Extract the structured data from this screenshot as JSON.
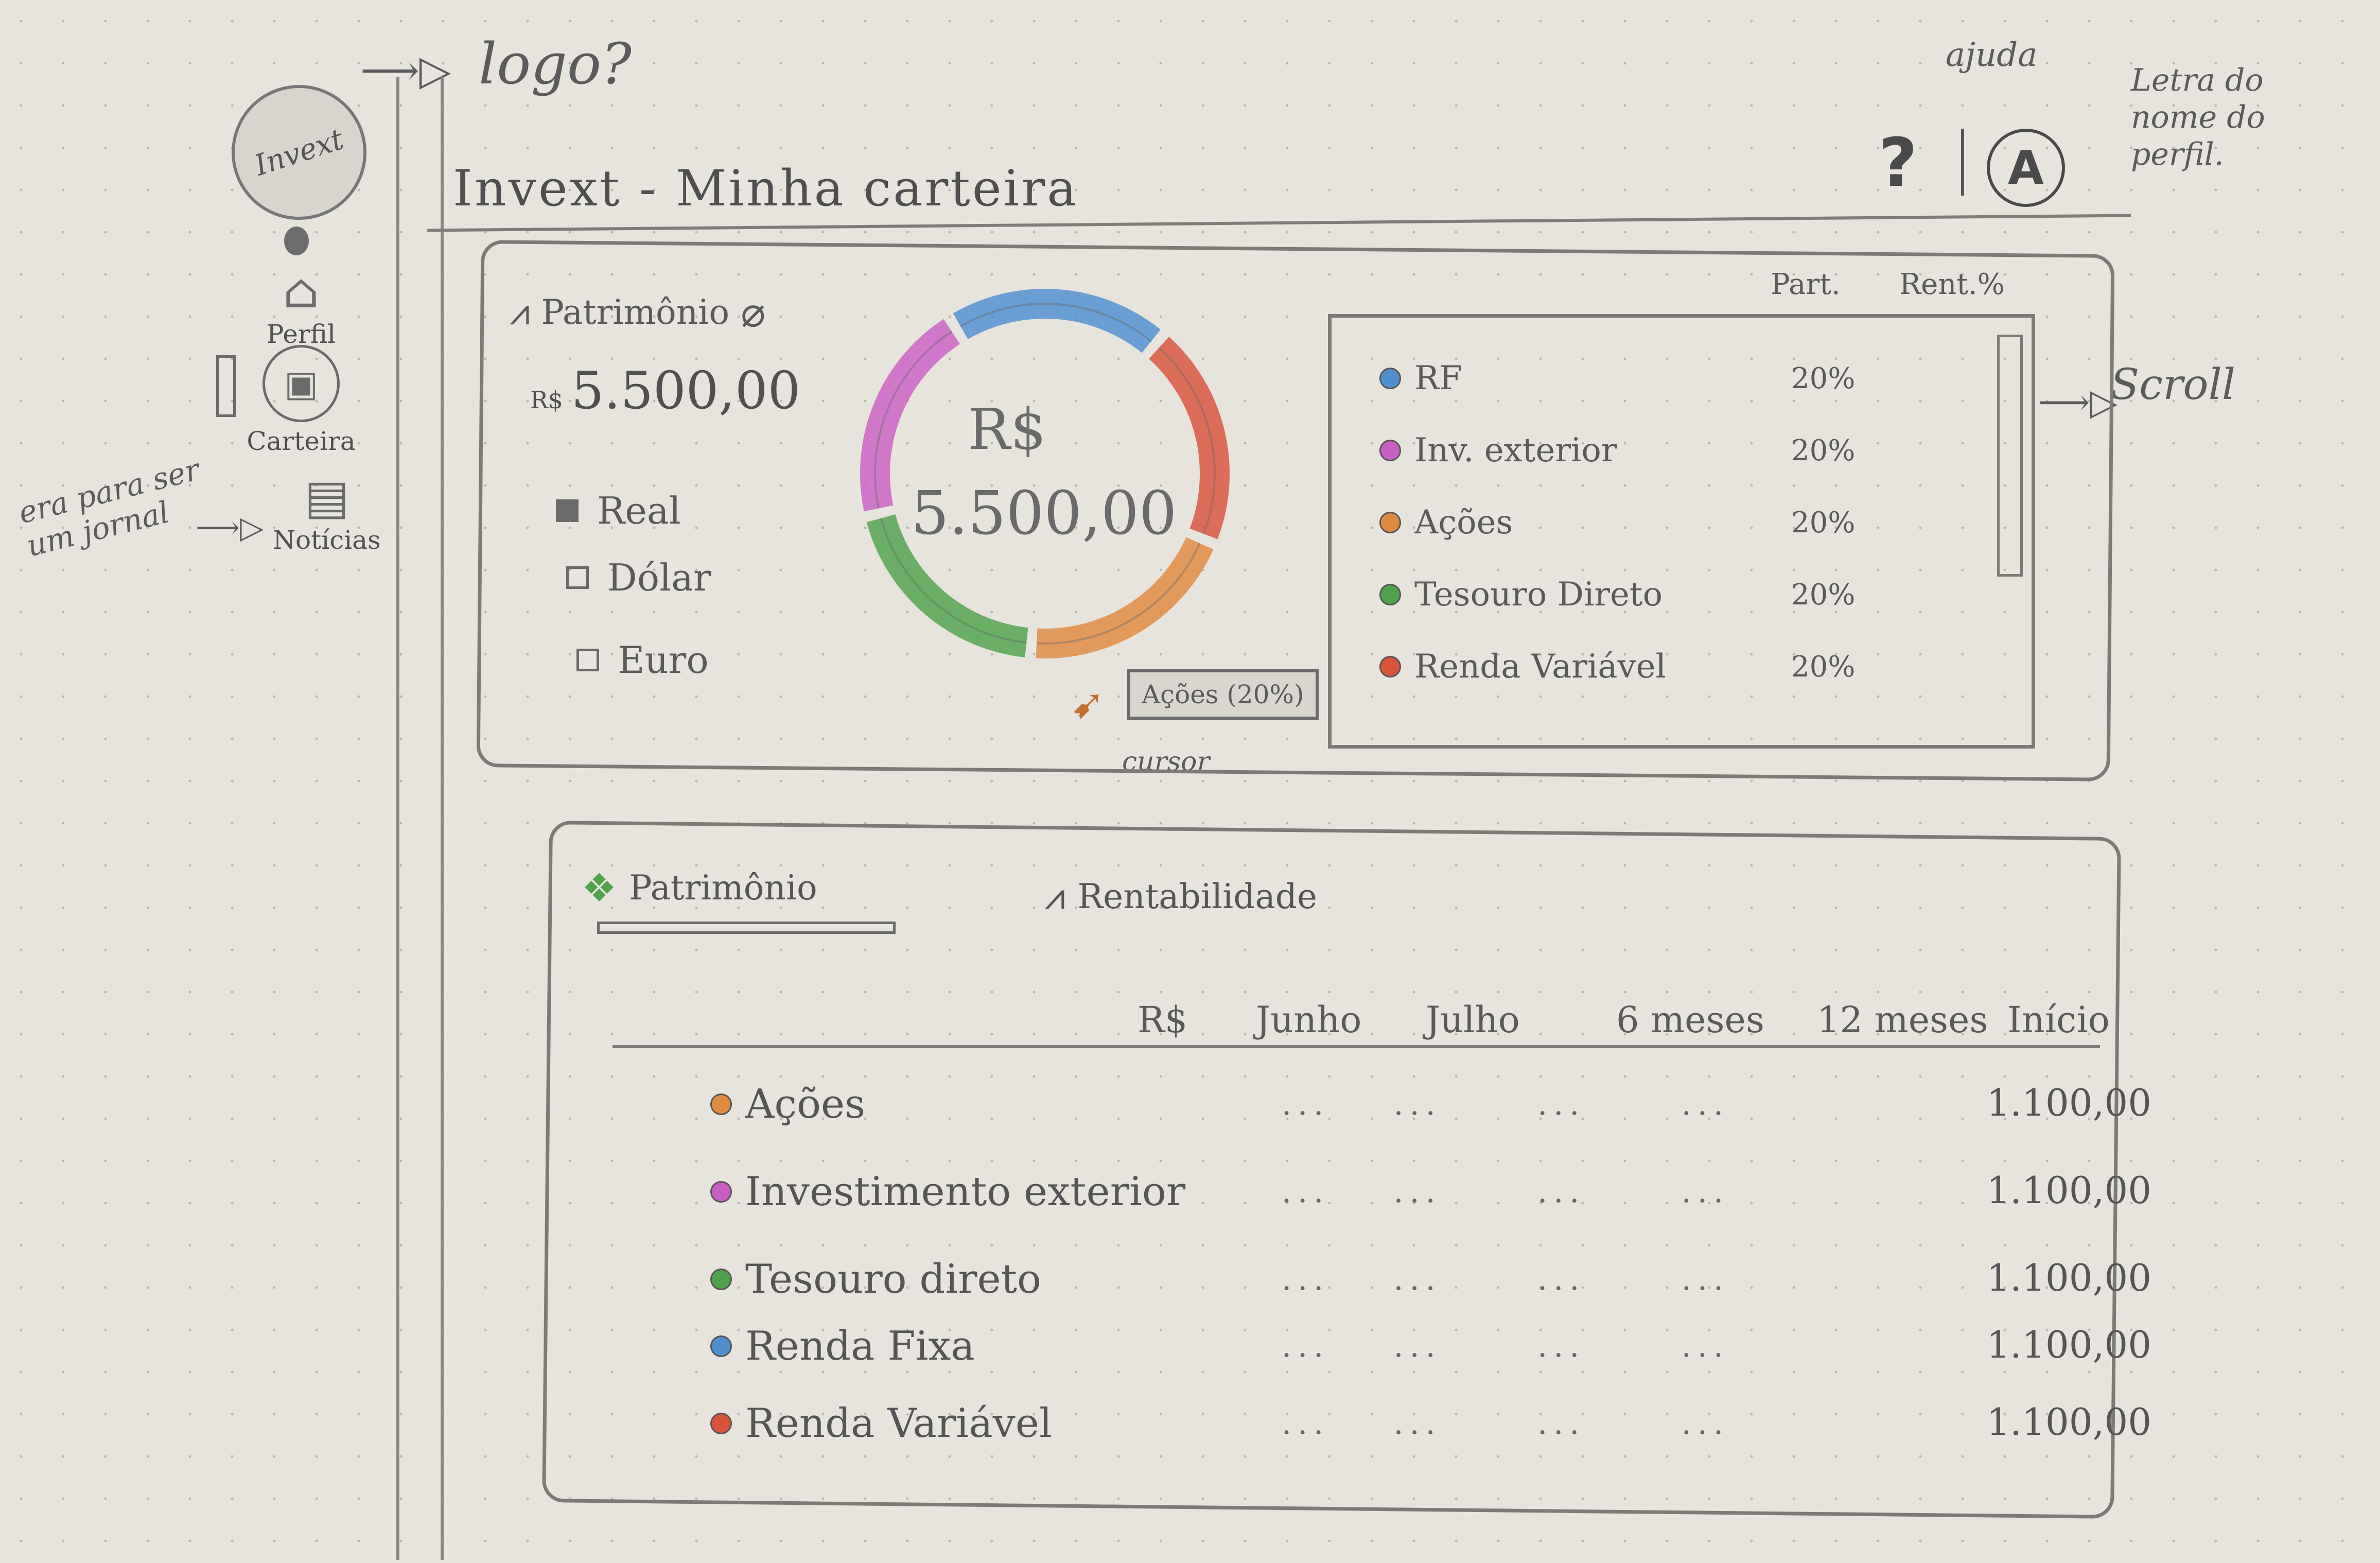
{
  "annotations": {
    "logo_note": "logo?",
    "help_note": "ajuda",
    "profile_note": "Letra do nome do perfil.",
    "scroll_note": "Scroll",
    "journal_note": "era para ser um jornal",
    "cursor_note": "cursor"
  },
  "app": {
    "logo_text": "Invext",
    "title": "Invext - Minha carteira",
    "help_icon_label": "?",
    "profile_letter": "A"
  },
  "sidebar": {
    "items": [
      {
        "label": "Perfil",
        "icon": "bank-icon"
      },
      {
        "label": "Carteira",
        "icon": "wallet-icon"
      },
      {
        "label": "Notícias",
        "icon": "newspaper-icon"
      }
    ]
  },
  "summary": {
    "heading": "Patrimônio",
    "total_prefix": "R$",
    "total": "5.500,00",
    "currency_options": [
      {
        "label": "Real",
        "checked": true
      },
      {
        "label": "Dólar",
        "checked": false
      },
      {
        "label": "Euro",
        "checked": false
      }
    ],
    "donut_currency": "R$",
    "donut_value": "5.500,00",
    "tooltip": "Ações (20%)",
    "allocation_header_part": "Part.",
    "allocation_header_rent": "Rent.%",
    "allocation": [
      {
        "name": "RF",
        "pct": "20%",
        "share": 20,
        "color": "#4f8fcf"
      },
      {
        "name": "Inv. exterior",
        "pct": "20%",
        "share": 20,
        "color": "#c95fc4"
      },
      {
        "name": "Ações",
        "pct": "20%",
        "share": 20,
        "color": "#e08a3f"
      },
      {
        "name": "Tesouro Direto",
        "pct": "20%",
        "share": 20,
        "color": "#4ea34a"
      },
      {
        "name": "Renda Variável",
        "pct": "20%",
        "share": 20,
        "color": "#d9533a"
      }
    ],
    "donut_segments": [
      {
        "color": "#4f8fcf",
        "share": 20
      },
      {
        "color": "#d9533a",
        "share": 20
      },
      {
        "color": "#e08a3f",
        "share": 20
      },
      {
        "color": "#4ea34a",
        "share": 20
      },
      {
        "color": "#c95fc4",
        "share": 20
      }
    ]
  },
  "details": {
    "tabs": [
      "Patrimônio",
      "Rentabilidade"
    ],
    "columns": [
      "R$",
      "Junho",
      "Julho",
      "6 meses",
      "12 meses",
      "Início"
    ],
    "rows": [
      {
        "label": "Ações",
        "value": "1.100,00",
        "color": "#e08a3f"
      },
      {
        "label": "Investimento exterior",
        "value": "1.100,00",
        "color": "#c95fc4"
      },
      {
        "label": "Tesouro direto",
        "value": "1.100,00",
        "color": "#4ea34a"
      },
      {
        "label": "Renda Fixa",
        "value": "1.100,00",
        "color": "#4f8fcf"
      },
      {
        "label": "Renda Variável",
        "value": "1.100,00",
        "color": "#d9533a"
      }
    ]
  }
}
